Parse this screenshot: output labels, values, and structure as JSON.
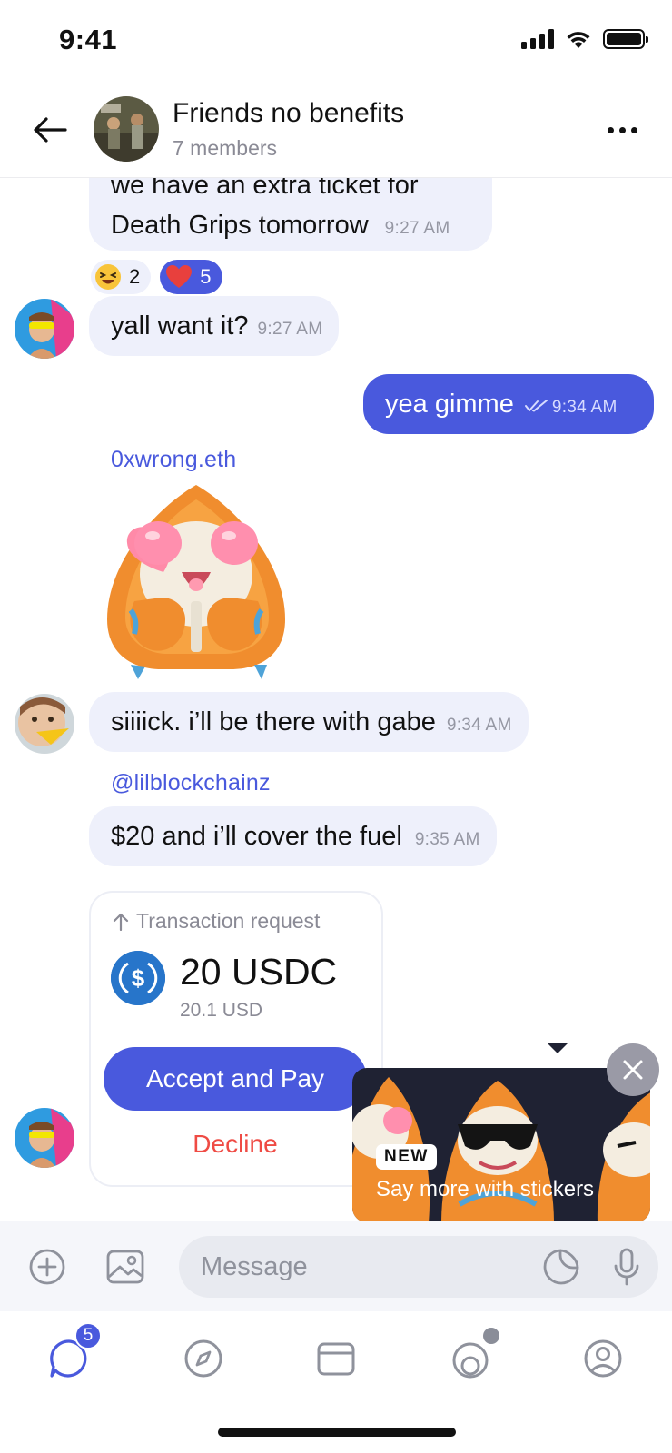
{
  "status_bar": {
    "time": "9:41"
  },
  "header": {
    "title": "Friends no benefits",
    "subtitle": "7 members"
  },
  "messages": {
    "m1": {
      "line1": "we have an extra ticket for",
      "line2": "Death Grips tomorrow",
      "time": "9:27 AM"
    },
    "reactions": [
      {
        "emoji": "laughing-face-icon",
        "count": "2"
      },
      {
        "emoji": "heart-icon",
        "count": "5"
      }
    ],
    "m2": {
      "text": "yall want it?",
      "time": "9:27 AM"
    },
    "m3": {
      "text": "yea gimme",
      "time": "9:34 AM"
    },
    "sender_sticker": "0xwrong.eth",
    "m4": {
      "text": "siiiick. i’ll be there with gabe",
      "time": "9:34 AM"
    },
    "sender_m5": "@lilblockchainz",
    "m5": {
      "text": "$20 and i’ll cover the fuel",
      "time": "9:35 AM"
    }
  },
  "transaction": {
    "label": "Transaction request",
    "amount": "20 USDC",
    "usd": "20.1 USD",
    "accept": "Accept and Pay",
    "decline": "Decline"
  },
  "sticker_tip": {
    "badge": "NEW",
    "text": "Say more with stickers"
  },
  "composer": {
    "placeholder": "Message"
  },
  "nav": {
    "chats_badge": "5"
  },
  "colors": {
    "accent": "#4959dd",
    "bubble_in": "#eef0fb",
    "decline": "#ef4b44",
    "tooltip_bg": "#1f2233"
  }
}
